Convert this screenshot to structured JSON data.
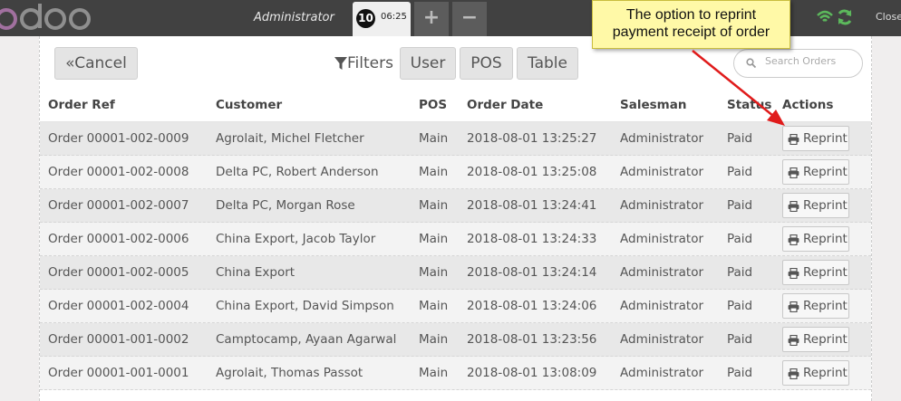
{
  "topbar": {
    "cashier": "Administrator",
    "order_number": "10",
    "order_time": "06:25",
    "add_label": "+",
    "remove_label": "−",
    "close_label": "Close"
  },
  "callout": {
    "line1": "The option to reprint",
    "line2": "payment receipt of order"
  },
  "toolbar": {
    "cancel_label": "Cancel",
    "filters_label": "Filters",
    "filter_user": "User",
    "filter_pos": "POS",
    "filter_table": "Table",
    "search_placeholder": "Search Orders"
  },
  "table": {
    "headers": [
      "Order Ref",
      "Customer",
      "POS",
      "Order Date",
      "Salesman",
      "Status",
      "Actions"
    ],
    "action_label": "Reprint",
    "rows": [
      {
        "ref": "Order 00001-002-0009",
        "customer": "Agrolait, Michel Fletcher",
        "pos": "Main",
        "date": "2018-08-01 13:25:27",
        "salesman": "Administrator",
        "status": "Paid"
      },
      {
        "ref": "Order 00001-002-0008",
        "customer": "Delta PC, Robert Anderson",
        "pos": "Main",
        "date": "2018-08-01 13:25:08",
        "salesman": "Administrator",
        "status": "Paid"
      },
      {
        "ref": "Order 00001-002-0007",
        "customer": "Delta PC, Morgan Rose",
        "pos": "Main",
        "date": "2018-08-01 13:24:41",
        "salesman": "Administrator",
        "status": "Paid"
      },
      {
        "ref": "Order 00001-002-0006",
        "customer": "China Export, Jacob Taylor",
        "pos": "Main",
        "date": "2018-08-01 13:24:33",
        "salesman": "Administrator",
        "status": "Paid"
      },
      {
        "ref": "Order 00001-002-0005",
        "customer": "China Export",
        "pos": "Main",
        "date": "2018-08-01 13:24:14",
        "salesman": "Administrator",
        "status": "Paid"
      },
      {
        "ref": "Order 00001-002-0004",
        "customer": "China Export, David Simpson",
        "pos": "Main",
        "date": "2018-08-01 13:24:06",
        "salesman": "Administrator",
        "status": "Paid"
      },
      {
        "ref": "Order 00001-001-0002",
        "customer": "Camptocamp, Ayaan Agarwal",
        "pos": "Main",
        "date": "2018-08-01 13:23:56",
        "salesman": "Administrator",
        "status": "Paid"
      },
      {
        "ref": "Order 00001-001-0001",
        "customer": "Agrolait, Thomas Passot",
        "pos": "Main",
        "date": "2018-08-01 13:08:09",
        "salesman": "Administrator",
        "status": "Paid"
      }
    ]
  },
  "colors": {
    "topbar_bg": "#414141",
    "logo": "#a1709f",
    "wifi_green": "#5cb85c",
    "callout_bg": "#fff9a7",
    "arrow_red": "#e01b1b"
  },
  "icons": [
    "odoo-logo",
    "wifi-icon",
    "sync-icon",
    "filter-icon",
    "search-icon",
    "print-icon",
    "chevron-double-left-icon"
  ]
}
